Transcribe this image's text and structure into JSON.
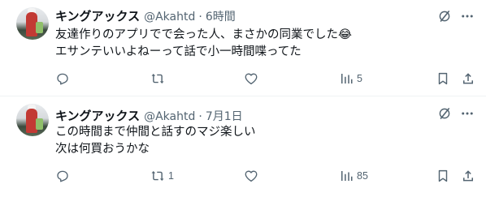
{
  "tweets": [
    {
      "name": "キングアックス",
      "handle": "@Akahtd",
      "time": "6時間",
      "lines": [
        "友達作りのアプリでで会った人、まさかの同業でした😂",
        "エサンテいいよねーって話で小一時間喋ってた"
      ],
      "reply_count": "",
      "retweet_count": "",
      "like_count": "",
      "view_count": "5"
    },
    {
      "name": "キングアックス",
      "handle": "@Akahtd",
      "time": "7月1日",
      "lines": [
        "この時間まで仲間と話すのマジ楽しい",
        "次は何買おうかな"
      ],
      "reply_count": "",
      "retweet_count": "1",
      "like_count": "",
      "view_count": "85"
    }
  ],
  "separator": "·",
  "icons": {
    "grok": "grok-icon",
    "more": "more-icon",
    "reply": "reply-icon",
    "retweet": "retweet-icon",
    "like": "like-icon",
    "views": "views-icon",
    "bookmark": "bookmark-icon",
    "share": "share-icon"
  },
  "colors": {
    "text": "#0f1419",
    "secondary": "#536471",
    "border": "#eff3f4"
  }
}
